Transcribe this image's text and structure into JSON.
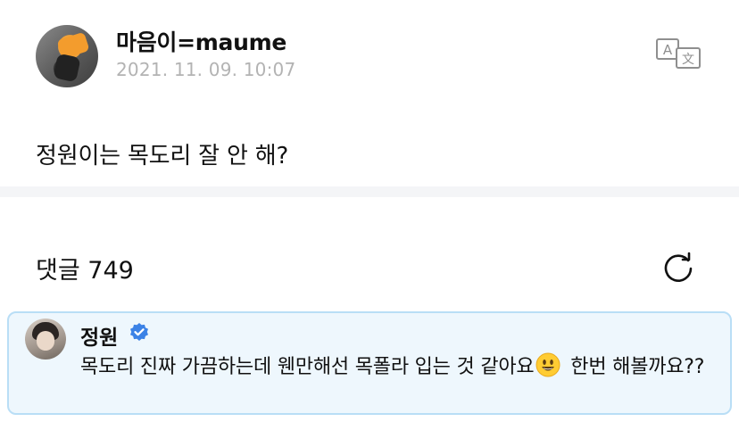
{
  "post": {
    "author": "마음이=maume",
    "date": "2021. 11. 09. 10:07",
    "body": "정원이는 목도리 잘 안 해?"
  },
  "comments": {
    "title": "댓글 749",
    "items": [
      {
        "author": "정원",
        "verified": true,
        "text_before_emoji": "목도리 진짜 가끔하는데 웬만해선 목폴라 입는 것 같아요",
        "emoji": "smiling-face-emoji",
        "text_after_emoji": " 한번 해볼까요??"
      }
    ]
  },
  "icons": {
    "translate": "translate-icon",
    "refresh": "refresh-icon",
    "verified": "verified-badge-icon"
  },
  "colors": {
    "accent": "#3b82e6",
    "comment_bg": "#eef7fd",
    "comment_border": "#b9def6",
    "date_gray": "#b3b3b3"
  }
}
